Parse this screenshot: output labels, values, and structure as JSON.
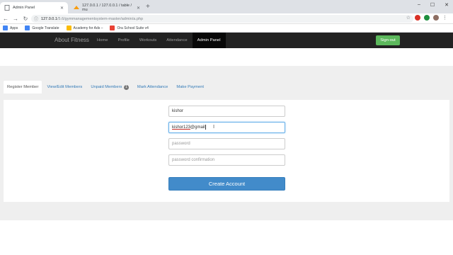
{
  "browser": {
    "tabs": [
      {
        "title": "Admin Panel",
        "active": true
      },
      {
        "title": "127.0.0.1 / 127.0.0.1 / table / mu",
        "active": false
      }
    ],
    "new_tab": "+",
    "window_controls": [
      "–",
      "☐",
      "✕"
    ],
    "url_host": "127.0.0.1",
    "url_path": "/5.6/gymmanagementsystem-master/admin/a.php",
    "bookmarks": [
      {
        "label": "Apps",
        "color": "#4285f4"
      },
      {
        "label": "Google Translate",
        "color": "#4285f4"
      },
      {
        "label": "Academy for Ads – ",
        "color": "#fbbc05"
      },
      {
        "label": "Ora School Suite v4",
        "color": "#e94235"
      }
    ]
  },
  "navbar": {
    "brand": "About Fitness",
    "links": [
      {
        "label": "Home",
        "active": false
      },
      {
        "label": "Profile",
        "active": false
      },
      {
        "label": "Workouts",
        "active": false
      },
      {
        "label": "Attendance",
        "active": false
      },
      {
        "label": "Admin Panel",
        "active": true
      }
    ],
    "signout_label": "Sign-out"
  },
  "tabs": [
    {
      "label": "Register Member",
      "active": true
    },
    {
      "label": "View/Edit Members",
      "active": false
    },
    {
      "label": "Unpaid Members",
      "badge": "1",
      "active": false
    },
    {
      "label": "Mark Attendance",
      "active": false
    },
    {
      "label": "Make Payment",
      "active": false
    }
  ],
  "form": {
    "username_value": "kishor",
    "email_value_underlined": "kishor123",
    "email_value_rest": "@gmail",
    "password_placeholder": "password",
    "password_confirm_placeholder": "password confirmation",
    "submit_label": "Create Account"
  },
  "colors": {
    "navbar_bg": "#222222",
    "signout_green": "#5cb85c",
    "primary_blue": "#428bca",
    "link_blue": "#337ab7"
  }
}
